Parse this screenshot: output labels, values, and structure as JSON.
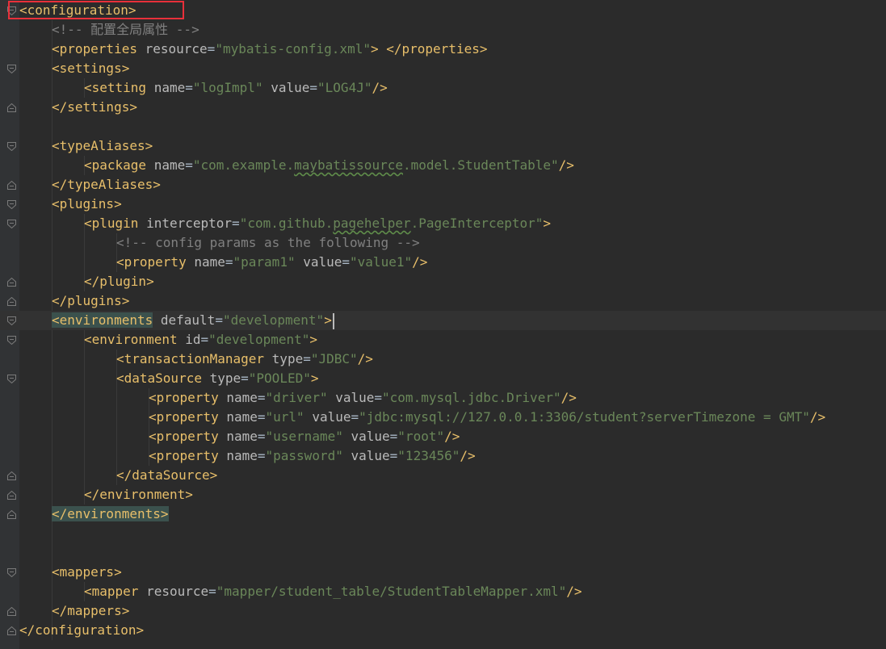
{
  "lines": [
    {
      "id": "config-open",
      "indent": 0,
      "fold": "start",
      "parts": [
        {
          "t": "tag",
          "v": "<configuration>"
        }
      ]
    },
    {
      "id": "comment-global",
      "indent": 1,
      "fold": "",
      "parts": [
        {
          "t": "comment",
          "v": "<!-- 配置全局属性 -->"
        }
      ]
    },
    {
      "id": "properties",
      "indent": 1,
      "fold": "",
      "parts": [
        {
          "t": "tag",
          "v": "<properties"
        },
        {
          "t": "sp",
          "v": " "
        },
        {
          "t": "attr",
          "v": "resource"
        },
        {
          "t": "eq",
          "v": "="
        },
        {
          "t": "val",
          "v": "\"mybatis-config.xml\""
        },
        {
          "t": "tag",
          "v": ">"
        },
        {
          "t": "sp",
          "v": " "
        },
        {
          "t": "tag",
          "v": "</properties>"
        }
      ]
    },
    {
      "id": "settings-open",
      "indent": 1,
      "fold": "start",
      "parts": [
        {
          "t": "tag",
          "v": "<settings>"
        }
      ]
    },
    {
      "id": "setting-logimpl",
      "indent": 2,
      "fold": "",
      "parts": [
        {
          "t": "tag",
          "v": "<setting"
        },
        {
          "t": "sp",
          "v": " "
        },
        {
          "t": "attr",
          "v": "name"
        },
        {
          "t": "eq",
          "v": "="
        },
        {
          "t": "val",
          "v": "\"logImpl\""
        },
        {
          "t": "sp",
          "v": " "
        },
        {
          "t": "attr",
          "v": "value"
        },
        {
          "t": "eq",
          "v": "="
        },
        {
          "t": "val",
          "v": "\"LOG4J\""
        },
        {
          "t": "tag",
          "v": "/>"
        }
      ]
    },
    {
      "id": "settings-close",
      "indent": 1,
      "fold": "end",
      "parts": [
        {
          "t": "tag",
          "v": "</settings>"
        }
      ]
    },
    {
      "id": "blank-1",
      "indent": 0,
      "fold": "",
      "parts": []
    },
    {
      "id": "typealiases-open",
      "indent": 1,
      "fold": "start",
      "parts": [
        {
          "t": "tag",
          "v": "<typeAliases>"
        }
      ]
    },
    {
      "id": "package",
      "indent": 2,
      "fold": "",
      "parts": [
        {
          "t": "tag",
          "v": "<package"
        },
        {
          "t": "sp",
          "v": " "
        },
        {
          "t": "attr",
          "v": "name"
        },
        {
          "t": "eq",
          "v": "="
        },
        {
          "t": "val",
          "v": "\"com.example."
        },
        {
          "t": "valtypo",
          "v": "maybatissource"
        },
        {
          "t": "val",
          "v": ".model.StudentTable\""
        },
        {
          "t": "tag",
          "v": "/>"
        }
      ]
    },
    {
      "id": "typealiases-close",
      "indent": 1,
      "fold": "end",
      "parts": [
        {
          "t": "tag",
          "v": "</typeAliases>"
        }
      ]
    },
    {
      "id": "plugins-open",
      "indent": 1,
      "fold": "start",
      "parts": [
        {
          "t": "tag",
          "v": "<plugins>"
        }
      ]
    },
    {
      "id": "plugin-open",
      "indent": 2,
      "fold": "start",
      "parts": [
        {
          "t": "tag",
          "v": "<plugin"
        },
        {
          "t": "sp",
          "v": " "
        },
        {
          "t": "attr",
          "v": "interceptor"
        },
        {
          "t": "eq",
          "v": "="
        },
        {
          "t": "val",
          "v": "\"com.github."
        },
        {
          "t": "valtypo",
          "v": "pagehelper"
        },
        {
          "t": "val",
          "v": ".PageInterceptor\""
        },
        {
          "t": "tag",
          "v": ">"
        }
      ]
    },
    {
      "id": "comment-config-params",
      "indent": 3,
      "fold": "",
      "parts": [
        {
          "t": "comment",
          "v": "<!-- config params as the following -->"
        }
      ]
    },
    {
      "id": "property-param1",
      "indent": 3,
      "fold": "",
      "parts": [
        {
          "t": "tag",
          "v": "<property"
        },
        {
          "t": "sp",
          "v": " "
        },
        {
          "t": "attr",
          "v": "name"
        },
        {
          "t": "eq",
          "v": "="
        },
        {
          "t": "val",
          "v": "\"param1\""
        },
        {
          "t": "sp",
          "v": " "
        },
        {
          "t": "attr",
          "v": "value"
        },
        {
          "t": "eq",
          "v": "="
        },
        {
          "t": "val",
          "v": "\"value1\""
        },
        {
          "t": "tag",
          "v": "/>"
        }
      ]
    },
    {
      "id": "plugin-close",
      "indent": 2,
      "fold": "end",
      "parts": [
        {
          "t": "tag",
          "v": "</plugin>"
        }
      ]
    },
    {
      "id": "plugins-close",
      "indent": 1,
      "fold": "end",
      "parts": [
        {
          "t": "tag",
          "v": "</plugins>"
        }
      ]
    },
    {
      "id": "environments-open",
      "indent": 1,
      "fold": "start",
      "current": true,
      "parts": [
        {
          "t": "tagmatch",
          "v": "<environments"
        },
        {
          "t": "sp",
          "v": " "
        },
        {
          "t": "attr",
          "v": "default"
        },
        {
          "t": "eq",
          "v": "="
        },
        {
          "t": "val",
          "v": "\"development\""
        },
        {
          "t": "tag",
          "v": ">"
        },
        {
          "t": "caret",
          "v": ""
        }
      ]
    },
    {
      "id": "environment-open",
      "indent": 2,
      "fold": "start",
      "parts": [
        {
          "t": "tag",
          "v": "<environment"
        },
        {
          "t": "sp",
          "v": " "
        },
        {
          "t": "attr",
          "v": "id"
        },
        {
          "t": "eq",
          "v": "="
        },
        {
          "t": "val",
          "v": "\"development\""
        },
        {
          "t": "tag",
          "v": ">"
        }
      ]
    },
    {
      "id": "transaction-manager",
      "indent": 3,
      "fold": "",
      "parts": [
        {
          "t": "tag",
          "v": "<transactionManager"
        },
        {
          "t": "sp",
          "v": " "
        },
        {
          "t": "attr",
          "v": "type"
        },
        {
          "t": "eq",
          "v": "="
        },
        {
          "t": "val",
          "v": "\"JDBC\""
        },
        {
          "t": "tag",
          "v": "/>"
        }
      ]
    },
    {
      "id": "datasource-open",
      "indent": 3,
      "fold": "start",
      "parts": [
        {
          "t": "tag",
          "v": "<dataSource"
        },
        {
          "t": "sp",
          "v": " "
        },
        {
          "t": "attr",
          "v": "type"
        },
        {
          "t": "eq",
          "v": "="
        },
        {
          "t": "val",
          "v": "\"POOLED\""
        },
        {
          "t": "tag",
          "v": ">"
        }
      ]
    },
    {
      "id": "property-driver",
      "indent": 4,
      "fold": "",
      "parts": [
        {
          "t": "tag",
          "v": "<property"
        },
        {
          "t": "sp",
          "v": " "
        },
        {
          "t": "attr",
          "v": "name"
        },
        {
          "t": "eq",
          "v": "="
        },
        {
          "t": "val",
          "v": "\"driver\""
        },
        {
          "t": "sp",
          "v": " "
        },
        {
          "t": "attr",
          "v": "value"
        },
        {
          "t": "eq",
          "v": "="
        },
        {
          "t": "val",
          "v": "\"com.mysql.jdbc.Driver\""
        },
        {
          "t": "tag",
          "v": "/>"
        }
      ]
    },
    {
      "id": "property-url",
      "indent": 4,
      "fold": "",
      "parts": [
        {
          "t": "tag",
          "v": "<property"
        },
        {
          "t": "sp",
          "v": " "
        },
        {
          "t": "attr",
          "v": "name"
        },
        {
          "t": "eq",
          "v": "="
        },
        {
          "t": "val",
          "v": "\"url\""
        },
        {
          "t": "sp",
          "v": " "
        },
        {
          "t": "attr",
          "v": "value"
        },
        {
          "t": "eq",
          "v": "="
        },
        {
          "t": "val",
          "v": "\"jdbc:mysql://127.0.0.1:3306/student?serverTimezone = GMT\""
        },
        {
          "t": "tag",
          "v": "/>"
        }
      ]
    },
    {
      "id": "property-username",
      "indent": 4,
      "fold": "",
      "parts": [
        {
          "t": "tag",
          "v": "<property"
        },
        {
          "t": "sp",
          "v": " "
        },
        {
          "t": "attr",
          "v": "name"
        },
        {
          "t": "eq",
          "v": "="
        },
        {
          "t": "val",
          "v": "\"username\""
        },
        {
          "t": "sp",
          "v": " "
        },
        {
          "t": "attr",
          "v": "value"
        },
        {
          "t": "eq",
          "v": "="
        },
        {
          "t": "val",
          "v": "\"root\""
        },
        {
          "t": "tag",
          "v": "/>"
        }
      ]
    },
    {
      "id": "property-password",
      "indent": 4,
      "fold": "",
      "parts": [
        {
          "t": "tag",
          "v": "<property"
        },
        {
          "t": "sp",
          "v": " "
        },
        {
          "t": "attr",
          "v": "name"
        },
        {
          "t": "eq",
          "v": "="
        },
        {
          "t": "val",
          "v": "\"password\""
        },
        {
          "t": "sp",
          "v": " "
        },
        {
          "t": "attr",
          "v": "value"
        },
        {
          "t": "eq",
          "v": "="
        },
        {
          "t": "val",
          "v": "\"123456\""
        },
        {
          "t": "tag",
          "v": "/>"
        }
      ]
    },
    {
      "id": "datasource-close",
      "indent": 3,
      "fold": "end",
      "parts": [
        {
          "t": "tag",
          "v": "</dataSource>"
        }
      ]
    },
    {
      "id": "environment-close",
      "indent": 2,
      "fold": "end",
      "parts": [
        {
          "t": "tag",
          "v": "</environment>"
        }
      ]
    },
    {
      "id": "environments-close",
      "indent": 1,
      "fold": "end",
      "parts": [
        {
          "t": "tagmatch",
          "v": "</environments>"
        }
      ]
    },
    {
      "id": "blank-2",
      "indent": 0,
      "fold": "",
      "parts": []
    },
    {
      "id": "blank-3",
      "indent": 0,
      "fold": "",
      "parts": []
    },
    {
      "id": "mappers-open",
      "indent": 1,
      "fold": "start",
      "parts": [
        {
          "t": "tag",
          "v": "<mappers>"
        }
      ]
    },
    {
      "id": "mapper",
      "indent": 2,
      "fold": "",
      "parts": [
        {
          "t": "tag",
          "v": "<mapper"
        },
        {
          "t": "sp",
          "v": " "
        },
        {
          "t": "attr",
          "v": "resource"
        },
        {
          "t": "eq",
          "v": "="
        },
        {
          "t": "val",
          "v": "\"mapper/student_table/StudentTableMapper.xml\""
        },
        {
          "t": "tag",
          "v": "/>"
        }
      ]
    },
    {
      "id": "mappers-close",
      "indent": 1,
      "fold": "end",
      "parts": [
        {
          "t": "tag",
          "v": "</mappers>"
        }
      ]
    },
    {
      "id": "config-close",
      "indent": 0,
      "fold": "end",
      "parts": [
        {
          "t": "tag",
          "v": "</configuration>"
        }
      ]
    }
  ],
  "colors": {
    "background": "#2b2b2b",
    "gutter": "#313335",
    "tag": "#e8bf6a",
    "attribute": "#bababa",
    "value": "#6a8759",
    "comment": "#808080",
    "bracket_match": "#3b514d",
    "annotation_box": "#e8303a"
  }
}
